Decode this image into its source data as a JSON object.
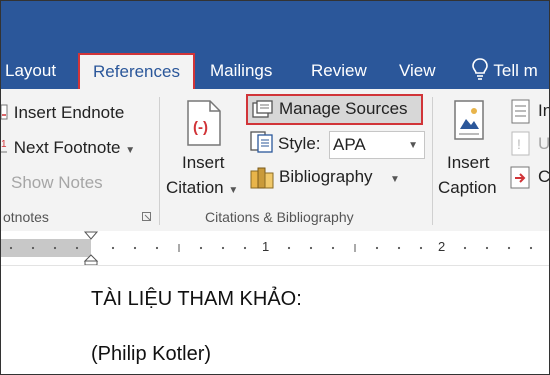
{
  "tabs": {
    "layout": "Layout",
    "references": "References",
    "mailings": "Mailings",
    "review": "Review",
    "view": "View",
    "tell_me": "Tell m"
  },
  "footnotes": {
    "insert_endnote": "Insert Endnote",
    "next_footnote": "Next Footnote",
    "show_notes": "Show Notes",
    "group_label": "otnotes"
  },
  "citations": {
    "insert_citation_line1": "Insert",
    "insert_citation_line2": "Citation",
    "manage_sources": "Manage Sources",
    "style_label": "Style:",
    "style_value": "APA",
    "bibliography": "Bibliography",
    "group_label": "Citations & Bibliography"
  },
  "captions": {
    "insert_caption_line1": "Insert",
    "insert_caption_line2": "Caption",
    "partial_1": "In",
    "partial_2": "U",
    "partial_3": "C"
  },
  "ruler": {
    "mark_1": "1",
    "mark_2": "2"
  },
  "document": {
    "line_1": "TÀI LIỆU THAM KHẢO:",
    "line_2": "(Philip Kotler)"
  },
  "colors": {
    "ribbon_blue": "#2b579a",
    "highlight_red": "#d13438",
    "ribbon_bg": "#f3f3f3"
  }
}
